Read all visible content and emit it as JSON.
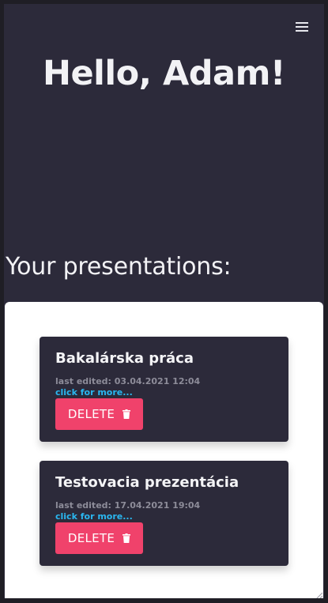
{
  "header": {
    "menu_icon": "hamburger-menu-icon",
    "greeting": "Hello, Adam!"
  },
  "main": {
    "section_title": "Your presentations:",
    "presentations": [
      {
        "title": "Bakalárska práca",
        "last_edited": "last edited: 03.04.2021 12:04",
        "link_label": "click for more...",
        "delete_label": "DELETE",
        "delete_icon": "trash-icon"
      },
      {
        "title": "Testovacia prezentácia",
        "last_edited": "last edited: 17.04.2021 19:04",
        "link_label": "click for more...",
        "delete_label": "DELETE",
        "delete_icon": "trash-icon"
      }
    ]
  },
  "colors": {
    "background": "#2c2a3a",
    "panel": "#ffffff",
    "card": "#2c2a3a",
    "accent_delete": "#f0426b",
    "link": "#2ab7f0",
    "meta_text": "#8d8c99"
  }
}
